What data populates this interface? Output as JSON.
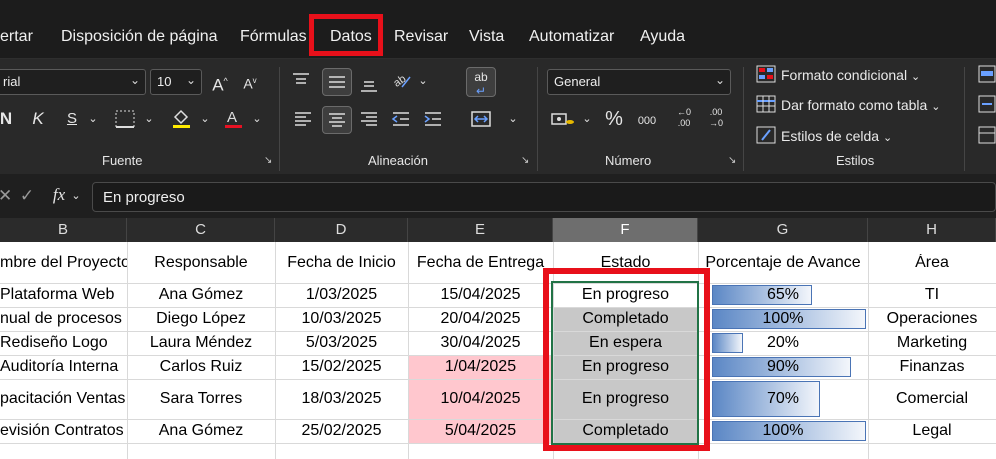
{
  "menu": {
    "tabs": [
      "ertar",
      "Disposición de página",
      "Fórmulas",
      "Datos",
      "Revisar",
      "Vista",
      "Automatizar",
      "Ayuda"
    ]
  },
  "ribbon": {
    "font_name": "rial",
    "font_size": "10",
    "bold_glyph": "N",
    "italic_glyph": "K",
    "underline_glyph": "S",
    "number_format": "General",
    "percent_glyph": "%",
    "thousands_glyph": "000",
    "wrap_glyph": "ab",
    "group_labels": {
      "fuente": "Fuente",
      "alineacion": "Alineación",
      "numero": "Número",
      "estilos": "Estilos"
    },
    "styles": {
      "conditional": "Formato condicional",
      "as_table": "Dar formato como tabla",
      "cell_styles": "Estilos de celda"
    }
  },
  "formula_bar": {
    "fx": "fx",
    "value": "En progreso"
  },
  "sheet": {
    "columns": [
      "B",
      "C",
      "D",
      "E",
      "F",
      "G",
      "H"
    ],
    "headers": [
      "mbre del Proyecto",
      "Responsable",
      "Fecha de Inicio",
      "Fecha de Entrega",
      "Estado",
      "Porcentaje de Avance",
      "Área"
    ],
    "rows": [
      {
        "project": "Plataforma Web",
        "owner": "Ana Gómez",
        "start": "1/03/2025",
        "due": "15/04/2025",
        "status": "En progreso",
        "progress": "65%",
        "area": "TI"
      },
      {
        "project": "nual de procesos",
        "owner": "Diego López",
        "start": "10/03/2025",
        "due": "20/04/2025",
        "status": "Completado",
        "progress": "100%",
        "area": "Operaciones"
      },
      {
        "project": "Rediseño Logo",
        "owner": "Laura Méndez",
        "start": "5/03/2025",
        "due": "30/04/2025",
        "status": "En espera",
        "progress": "20%",
        "area": "Marketing"
      },
      {
        "project": "Auditoría Interna",
        "owner": "Carlos Ruiz",
        "start": "15/02/2025",
        "due": "1/04/2025",
        "status": "En progreso",
        "progress": "90%",
        "area": "Finanzas"
      },
      {
        "project": "pacitación Ventas",
        "owner": "Sara Torres",
        "start": "18/03/2025",
        "due": "10/04/2025",
        "status": "En progreso",
        "progress": "70%",
        "area": "Comercial"
      },
      {
        "project": "evisión Contratos",
        "owner": "Ana Gómez",
        "start": "25/02/2025",
        "due": "5/04/2025",
        "status": "Completado",
        "progress": "100%",
        "area": "Legal"
      }
    ],
    "progress_values": [
      0.65,
      1.0,
      0.2,
      0.9,
      0.7,
      1.0
    ],
    "overdue_rows": [
      3,
      4,
      5
    ],
    "grey_status_rows": [
      1,
      2,
      3,
      4,
      5,
      6
    ]
  },
  "colors": {
    "highlight": "#e8101a",
    "overdue_fill": "#ffc7ce",
    "bar": "#5b87c5",
    "selection": "#217346"
  }
}
